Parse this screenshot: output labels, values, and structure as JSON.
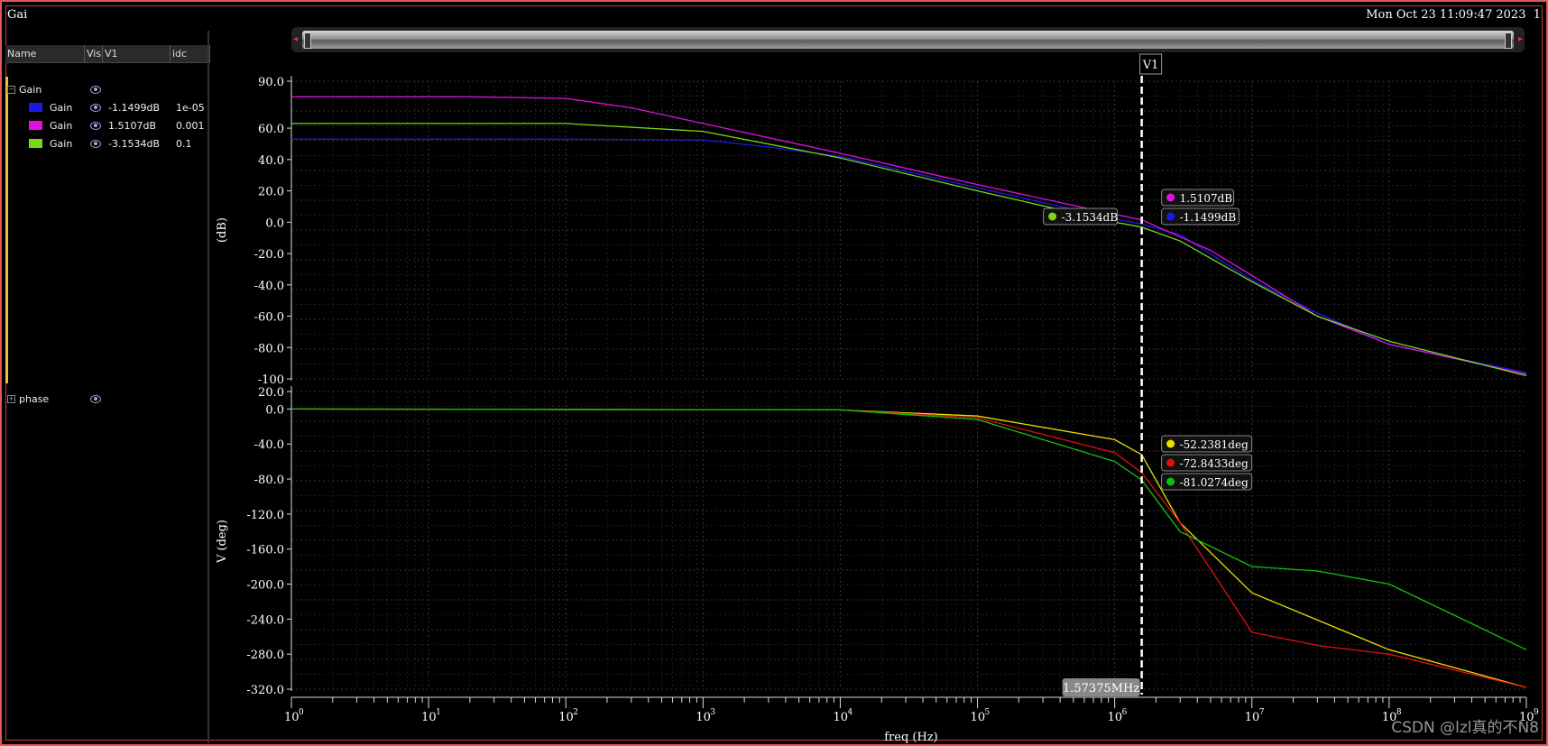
{
  "window": {
    "title": "Gai",
    "timestamp": "Mon Oct 23 11:09:47 2023  1"
  },
  "legend": {
    "columns": [
      "Name",
      "Vis",
      "V1",
      "idc"
    ],
    "groups": [
      {
        "name": "Gain",
        "expanded": true,
        "items": [
          {
            "name": "Gain",
            "color": "#1a1ae6",
            "v1": "-1.1499dB",
            "idc": "1e-05"
          },
          {
            "name": "Gain",
            "color": "#e010e0",
            "v1": "1.5107dB",
            "idc": "0.001"
          },
          {
            "name": "Gain",
            "color": "#78d818",
            "v1": "-3.1534dB",
            "idc": "0.1"
          }
        ]
      },
      {
        "name": "phase",
        "expanded": false,
        "items": []
      }
    ]
  },
  "cursor": {
    "name": "V1",
    "freq_label": "1.57375MHz",
    "freq": 1573750
  },
  "markers_gain": [
    {
      "text": "1.5107dB",
      "color": "#e010e0"
    },
    {
      "text": "-1.1499dB",
      "color": "#1a1ae6"
    },
    {
      "text": "-3.1534dB",
      "color": "#78d818"
    }
  ],
  "markers_phase": [
    {
      "text": "-52.2381deg",
      "color": "#e8e000"
    },
    {
      "text": "-72.8433deg",
      "color": "#e01010"
    },
    {
      "text": "-81.0274deg",
      "color": "#10c010"
    }
  ],
  "chart_data": [
    {
      "type": "line",
      "title": "",
      "xlabel": "freq (Hz)",
      "ylabel": "(dB)",
      "xscale": "log",
      "xlim": [
        1,
        1000000000
      ],
      "ylim": [
        -100,
        90
      ],
      "yticks": [
        90,
        60,
        40,
        20,
        0,
        -20,
        -40,
        -60,
        -80,
        -100
      ],
      "ytick_labels": [
        "90.0",
        "60.0",
        "40.0",
        "20.0",
        "0.0",
        "-20.0",
        "-40.0",
        "-60.0",
        "-80.0",
        "-100"
      ],
      "grid": true,
      "series": [
        {
          "name": "Gain",
          "color": "#1a1ae6",
          "x": [
            1,
            100,
            1000,
            3000,
            10000,
            100000,
            1000000,
            1573750,
            3000000,
            10000000,
            30000000,
            100000000,
            1000000000
          ],
          "y": [
            53,
            53,
            52.5,
            48,
            42,
            22,
            2,
            -1.15,
            -8,
            -37,
            -58,
            -78,
            -96
          ]
        },
        {
          "name": "Gain",
          "color": "#e010e0",
          "x": [
            1,
            20,
            100,
            300,
            1000,
            10000,
            100000,
            1000000,
            1573750,
            5000000,
            10000000,
            30000000,
            100000000,
            1000000000
          ],
          "y": [
            80,
            80,
            79,
            73,
            63,
            44,
            24,
            5,
            1.51,
            -18,
            -34,
            -60,
            -78,
            -97
          ]
        },
        {
          "name": "Gain",
          "color": "#78d818",
          "x": [
            1,
            100,
            1000,
            10000,
            100000,
            1000000,
            1573750,
            3000000,
            10000000,
            30000000,
            100000000,
            1000000000
          ],
          "y": [
            63,
            63,
            58,
            41,
            20,
            0,
            -3.15,
            -12,
            -38,
            -60,
            -76,
            -98
          ]
        }
      ]
    },
    {
      "type": "line",
      "title": "",
      "xlabel": "freq (Hz)",
      "ylabel": "V (deg)",
      "xscale": "log",
      "xlim": [
        1,
        1000000000
      ],
      "ylim": [
        -320,
        20
      ],
      "yticks": [
        20,
        0,
        -40,
        -80,
        -120,
        -160,
        -200,
        -240,
        -280,
        -320
      ],
      "ytick_labels": [
        "20.0",
        "0.0",
        "-40.0",
        "-80.0",
        "-120.0",
        "-160.0",
        "-200.0",
        "-240.0",
        "-280.0",
        "-320.0"
      ],
      "xtick_labels": [
        "10",
        "10",
        "10",
        "10",
        "10",
        "10",
        "10",
        "10",
        "10",
        "10"
      ],
      "xtick_exponents": [
        "0",
        "1",
        "2",
        "3",
        "4",
        "5",
        "6",
        "7",
        "8",
        "9"
      ],
      "grid": true,
      "series": [
        {
          "name": "phase",
          "color": "#e8e000",
          "x": [
            1,
            10000,
            100000,
            1000000,
            1573750,
            3000000,
            10000000,
            100000000,
            1000000000
          ],
          "y": [
            0,
            -1,
            -8,
            -35,
            -52.24,
            -130,
            -210,
            -275,
            -318
          ]
        },
        {
          "name": "phase",
          "color": "#e01010",
          "x": [
            1,
            10000,
            100000,
            1000000,
            1573750,
            3000000,
            10000000,
            30000000,
            100000000,
            1000000000
          ],
          "y": [
            0,
            -1,
            -10,
            -50,
            -72.84,
            -130,
            -255,
            -270,
            -280,
            -318
          ]
        },
        {
          "name": "phase",
          "color": "#10c010",
          "x": [
            1,
            10000,
            100000,
            1000000,
            1573750,
            3000000,
            10000000,
            30000000,
            100000000,
            1000000000
          ],
          "y": [
            0,
            -1,
            -12,
            -60,
            -81.03,
            -140,
            -180,
            -185,
            -200,
            -275
          ]
        }
      ]
    }
  ],
  "watermark": "CSDN @lzl真的不N8"
}
